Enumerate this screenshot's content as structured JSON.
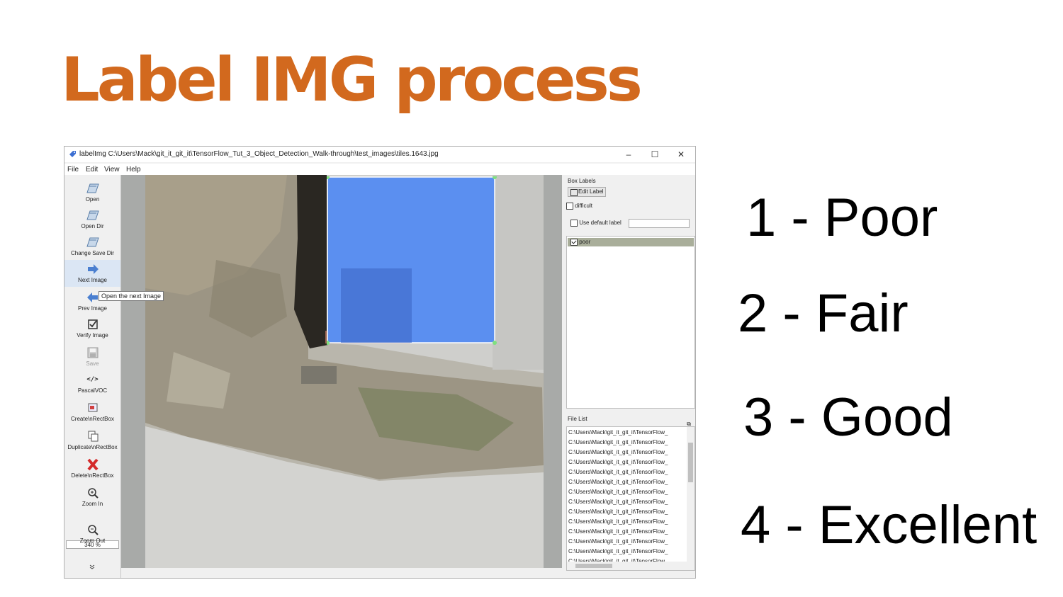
{
  "slide": {
    "title": "Label IMG process",
    "title_color": "#d2691e",
    "ratings": [
      "1 - Poor",
      "2 - Fair",
      "3 - Good",
      "4 - Excellent"
    ]
  },
  "window": {
    "title": "labelImg C:\\Users\\Mack\\git_it_git_it\\TensorFlow_Tut_3_Object_Detection_Walk-through\\test_images\\tiles.1643.jpg",
    "minimize": "–",
    "maximize": "☐",
    "close": "✕"
  },
  "menu": [
    "File",
    "Edit",
    "View",
    "Help"
  ],
  "toolbar": {
    "open": "Open",
    "open_dir": "Open Dir",
    "change_save_dir": "Change Save Dir",
    "next_image": "Next Image",
    "prev_image": "Prev Image",
    "verify_image": "Verify Image",
    "save": "Save",
    "pascal_voc": "PascalVOC",
    "pascal_icon": "</>",
    "create_rect_box": "Create\\nRectBox",
    "duplicate_rect_box": "Duplicate\\nRectBox",
    "delete_rect_box": "Delete\\nRectBox",
    "zoom_in": "Zoom In",
    "zoom_value": "340 %",
    "zoom_out": "Zoom Out"
  },
  "tooltip": "Open the next Image",
  "box_labels": {
    "header": "Box Labels",
    "edit_label": "Edit Label",
    "difficult": "difficult",
    "difficult_checked": false,
    "use_default_label": "Use default label",
    "use_default_checked": false,
    "default_label_value": "",
    "labels": [
      {
        "text": "poor",
        "checked": true
      }
    ],
    "selection_color": "#a9ae9a"
  },
  "file_list": {
    "header": "File List",
    "items": [
      "C:\\Users\\Mack\\git_it_git_it\\TensorFlow_",
      "C:\\Users\\Mack\\git_it_git_it\\TensorFlow_",
      "C:\\Users\\Mack\\git_it_git_it\\TensorFlow_",
      "C:\\Users\\Mack\\git_it_git_it\\TensorFlow_",
      "C:\\Users\\Mack\\git_it_git_it\\TensorFlow_",
      "C:\\Users\\Mack\\git_it_git_it\\TensorFlow_",
      "C:\\Users\\Mack\\git_it_git_it\\TensorFlow_",
      "C:\\Users\\Mack\\git_it_git_it\\TensorFlow_",
      "C:\\Users\\Mack\\git_it_git_it\\TensorFlow_",
      "C:\\Users\\Mack\\git_it_git_it\\TensorFlow_",
      "C:\\Users\\Mack\\git_it_git_it\\TensorFlow_",
      "C:\\Users\\Mack\\git_it_git_it\\TensorFlow_",
      "C:\\Users\\Mack\\git_it_git_it\\TensorFlow_",
      "C:\\Users\\Mack\\git_it_git_it\\TensorFlow_"
    ]
  },
  "canvas": {
    "bbox_fill": "#5b8ff0",
    "bbox_stroke": "#7fe07f"
  }
}
